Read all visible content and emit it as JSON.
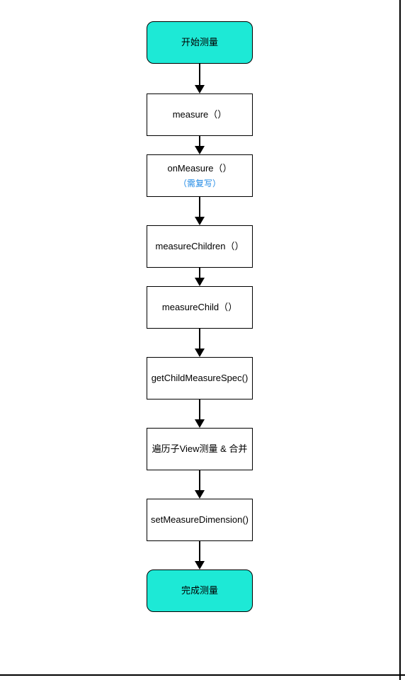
{
  "chart_data": {
    "type": "flowchart",
    "direction": "top-to-bottom",
    "nodes": [
      {
        "id": "start",
        "type": "terminal",
        "label": "开始测量"
      },
      {
        "id": "measure",
        "type": "process",
        "label": "measure（）"
      },
      {
        "id": "onMeasure",
        "type": "process",
        "label": "onMeasure（）",
        "sublabel": "（需复写）"
      },
      {
        "id": "measureChildren",
        "type": "process",
        "label": "measureChildren（）"
      },
      {
        "id": "measureChild",
        "type": "process",
        "label": "measureChild（）"
      },
      {
        "id": "getChildMeasureSpec",
        "type": "process",
        "label": "getChildMeasureSpec()"
      },
      {
        "id": "traverse",
        "type": "process",
        "label": "遍历子View测量 & 合并"
      },
      {
        "id": "setMeasureDimension",
        "type": "process",
        "label": "setMeasureDimension()"
      },
      {
        "id": "end",
        "type": "terminal",
        "label": "完成测量"
      }
    ],
    "edges": [
      {
        "from": "start",
        "to": "measure"
      },
      {
        "from": "measure",
        "to": "onMeasure"
      },
      {
        "from": "onMeasure",
        "to": "measureChildren"
      },
      {
        "from": "measureChildren",
        "to": "measureChild"
      },
      {
        "from": "measureChild",
        "to": "getChildMeasureSpec"
      },
      {
        "from": "getChildMeasureSpec",
        "to": "traverse"
      },
      {
        "from": "traverse",
        "to": "setMeasureDimension"
      },
      {
        "from": "setMeasureDimension",
        "to": "end"
      }
    ],
    "colors": {
      "terminal_fill": "#1DE9D6",
      "process_fill": "#FFFFFF",
      "border": "#000000",
      "sublabel": "#1E88E5"
    }
  }
}
